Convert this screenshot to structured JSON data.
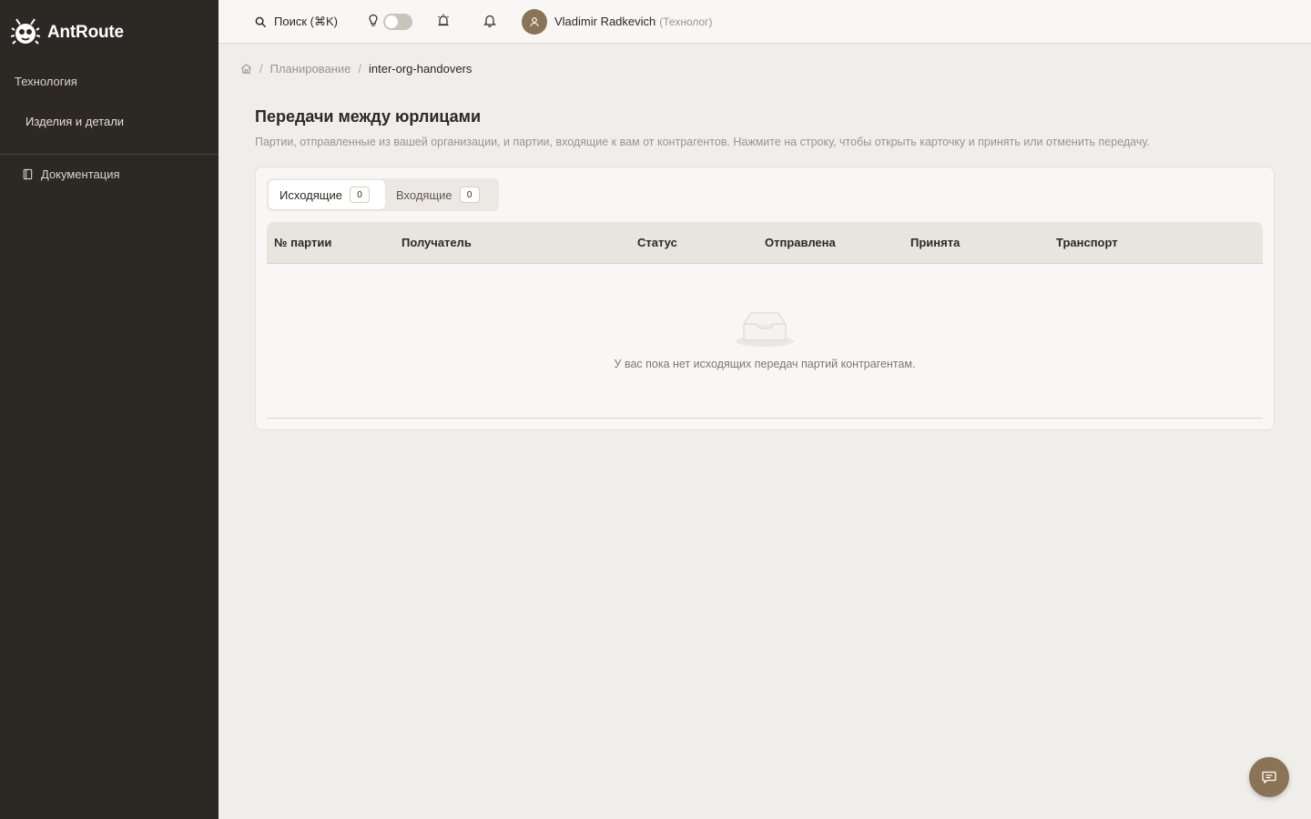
{
  "sidebar": {
    "app_name": "AntRoute",
    "group_label": "Технология",
    "items": [
      {
        "label": "Изделия и детали"
      }
    ],
    "docs_label": "Документация"
  },
  "topbar": {
    "search_label": "Поиск (⌘K)",
    "theme_toggle": "off",
    "user_name": "Vladimir Radkevich",
    "user_role": "(Технолог)"
  },
  "breadcrumb": {
    "items": [
      "Планирование",
      "inter-org-handovers"
    ]
  },
  "page": {
    "title": "Передачи между юрлицами",
    "description": "Партии, отправленные из вашей организации, и партии, входящие к вам от контрагентов. Нажмите на строку, чтобы открыть карточку и принять или отменить передачу."
  },
  "tabs": [
    {
      "label": "Исходящие",
      "count": "0",
      "active": true
    },
    {
      "label": "Входящие",
      "count": "0",
      "active": false
    }
  ],
  "table": {
    "columns": [
      "№ партии",
      "Получатель",
      "Статус",
      "Отправлена",
      "Принята",
      "Транспорт"
    ],
    "rows": [],
    "empty_text": "У вас пока нет исходящих передач партий контрагентам."
  },
  "colors": {
    "sidebar_bg": "#2c2824",
    "accent": "#8b7355",
    "page_bg": "#f0eeea"
  }
}
